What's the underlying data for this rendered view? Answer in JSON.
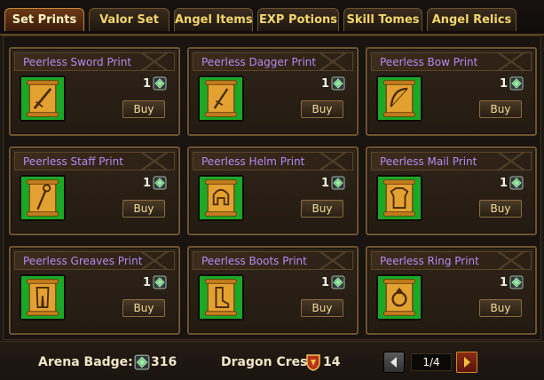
{
  "tabs": [
    {
      "label": "Set Prints",
      "active": true
    },
    {
      "label": "Valor Set",
      "active": false
    },
    {
      "label": "Angel Items",
      "active": false
    },
    {
      "label": "EXP Potions",
      "active": false
    },
    {
      "label": "Skill Tomes",
      "active": false
    },
    {
      "label": "Angel Relics",
      "active": false
    }
  ],
  "items": [
    {
      "name": "Peerless Sword Print",
      "qty": "1",
      "buy": "Buy",
      "icon": "sword-scroll-icon"
    },
    {
      "name": "Peerless Dagger Print",
      "qty": "1",
      "buy": "Buy",
      "icon": "dagger-scroll-icon"
    },
    {
      "name": "Peerless Bow Print",
      "qty": "1",
      "buy": "Buy",
      "icon": "bow-scroll-icon"
    },
    {
      "name": "Peerless Staff Print",
      "qty": "1",
      "buy": "Buy",
      "icon": "staff-scroll-icon"
    },
    {
      "name": "Peerless Helm Print",
      "qty": "1",
      "buy": "Buy",
      "icon": "helm-scroll-icon"
    },
    {
      "name": "Peerless Mail Print",
      "qty": "1",
      "buy": "Buy",
      "icon": "mail-scroll-icon"
    },
    {
      "name": "Peerless Greaves Print",
      "qty": "1",
      "buy": "Buy",
      "icon": "greaves-scroll-icon"
    },
    {
      "name": "Peerless Boots Print",
      "qty": "1",
      "buy": "Buy",
      "icon": "boots-scroll-icon"
    },
    {
      "name": "Peerless Ring Print",
      "qty": "1",
      "buy": "Buy",
      "icon": "ring-scroll-icon"
    }
  ],
  "currency": {
    "arena_label": "Arena Badge:",
    "arena_value": "316",
    "dragon_label": "Dragon Crest",
    "dragon_value": "14"
  },
  "pagination": {
    "indicator": "1/4"
  },
  "colors": {
    "item_name": "#b58af0",
    "tab_text": "#f1d56c",
    "slot_green": "#1aa826",
    "card_border": "#6e5432"
  }
}
